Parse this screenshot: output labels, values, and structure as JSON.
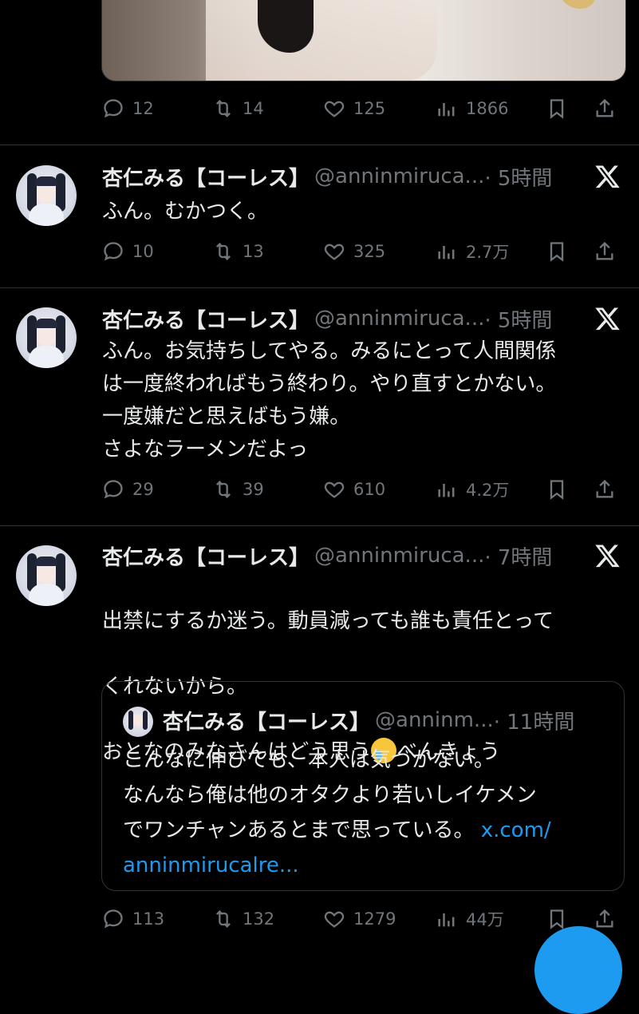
{
  "tweets": [
    {
      "stats": {
        "replies": "12",
        "retweets": "14",
        "likes": "125",
        "views": "1866"
      }
    },
    {
      "name": "杏仁みる【コーレス】",
      "handle": "@anninmiruca...",
      "time": "· 5時間",
      "text": "ふん。むかつく。",
      "stats": {
        "replies": "10",
        "retweets": "13",
        "likes": "325",
        "views": "2.7万"
      }
    },
    {
      "name": "杏仁みる【コーレス】",
      "handle": "@anninmiruca...",
      "time": "· 5時間",
      "text": "ふん。お気持ちしてやる。みるにとって人間関係\nは一度終わればもう終わり。やり直すとかない。\n一度嫌だと思えばもう嫌。\nさよなラーメンだよっ",
      "stats": {
        "replies": "29",
        "retweets": "39",
        "likes": "610",
        "views": "4.2万"
      }
    },
    {
      "name": "杏仁みる【コーレス】",
      "handle": "@anninmiruca...",
      "time": "· 7時間",
      "text_line1": "出禁にするか迷う。動員減っても誰も責任とって",
      "text_line2": "くれないから。",
      "text_line3a": "おとなのみなさんはどう思う",
      "emoji": "crying-face",
      "text_line3b": "べんきょう",
      "quote": {
        "name": "杏仁みる【コーレス】",
        "handle": "@anninm...",
        "time": "· 11時間",
        "line1": "こんなに伸びても、本人は気づかない。",
        "line2": "なんなら俺は他のオタクより若いしイケメン",
        "line3": "でワンチャンあるとまで思っている。 ",
        "link1": "x.com/",
        "link2": "anninmirucalre..."
      },
      "stats": {
        "replies": "113",
        "retweets": "132",
        "likes": "1279",
        "views": "44万"
      }
    }
  ],
  "colors": {
    "background": "#000000",
    "text": "#e7e9ea",
    "muted": "#71767b",
    "accent": "#1d9bf0",
    "border": "#2f3336"
  }
}
